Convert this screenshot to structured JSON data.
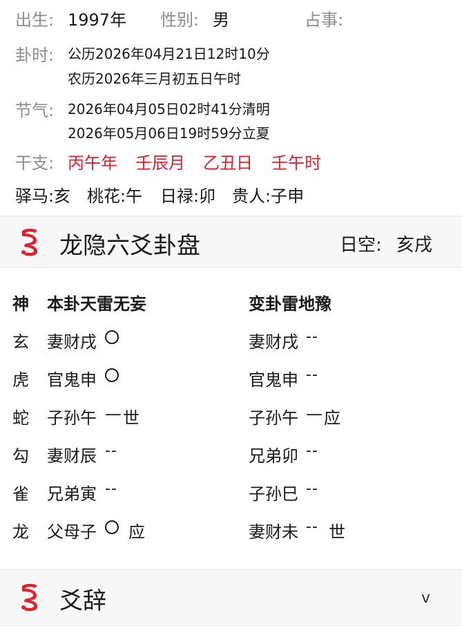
{
  "header": {
    "birth_label": "出生:",
    "birth_value": "1997年",
    "gender_label": "性别:",
    "gender_value": "男",
    "matter_label": "占事:",
    "time_label": "卦时:",
    "time_solar": "公历2026年04月21日12时10分",
    "time_lunar": "农历2026年三月初五日午时",
    "term_label": "节气:",
    "term_1": "2026年04月05日02时41分清明",
    "term_2": "2026年05月06日19时59分立夏",
    "ganzhi_label": "干支:",
    "ganzhi": [
      "丙午年",
      "壬辰月",
      "乙丑日",
      "壬午时"
    ],
    "shensha": [
      "驿马:亥",
      "桃花:午",
      "日禄:卯",
      "贵人:子申"
    ]
  },
  "panel": {
    "title": "龙隐六爻卦盘",
    "kong_label": "日空:",
    "kong_value": "亥戌",
    "headers": [
      "神",
      "本卦天雷无妄",
      "变卦雷地豫"
    ],
    "rows": [
      {
        "god": "玄",
        "ben": "妻财戌",
        "ben_mark": "circle",
        "ben_tag": "",
        "bian": "妻财戌",
        "bian_line": "--",
        "bian_tag": ""
      },
      {
        "god": "虎",
        "ben": "官鬼申",
        "ben_mark": "circle",
        "ben_tag": "",
        "bian": "官鬼申",
        "bian_line": "--",
        "bian_tag": ""
      },
      {
        "god": "蛇",
        "ben": "子孙午",
        "ben_mark": "—",
        "ben_tag": "世",
        "bian": "子孙午",
        "bian_line": "—",
        "bian_tag": "应"
      },
      {
        "god": "勾",
        "ben": "妻财辰",
        "ben_mark": "--",
        "ben_tag": "",
        "bian": "兄弟卯",
        "bian_line": "--",
        "bian_tag": ""
      },
      {
        "god": "雀",
        "ben": "兄弟寅",
        "ben_mark": "--",
        "ben_tag": "",
        "bian": "子孙巳",
        "bian_line": "--",
        "bian_tag": ""
      },
      {
        "god": "龙",
        "ben": "父母子",
        "ben_mark": "circle",
        "ben_tag": "应",
        "bian": "妻财未",
        "bian_line": "--",
        "bian_tag": "世"
      }
    ]
  },
  "section2": {
    "title": "爻辞",
    "chevron": "v"
  },
  "icons": {
    "logo": "dragon-logo-icon",
    "accent": "#e0212b"
  }
}
